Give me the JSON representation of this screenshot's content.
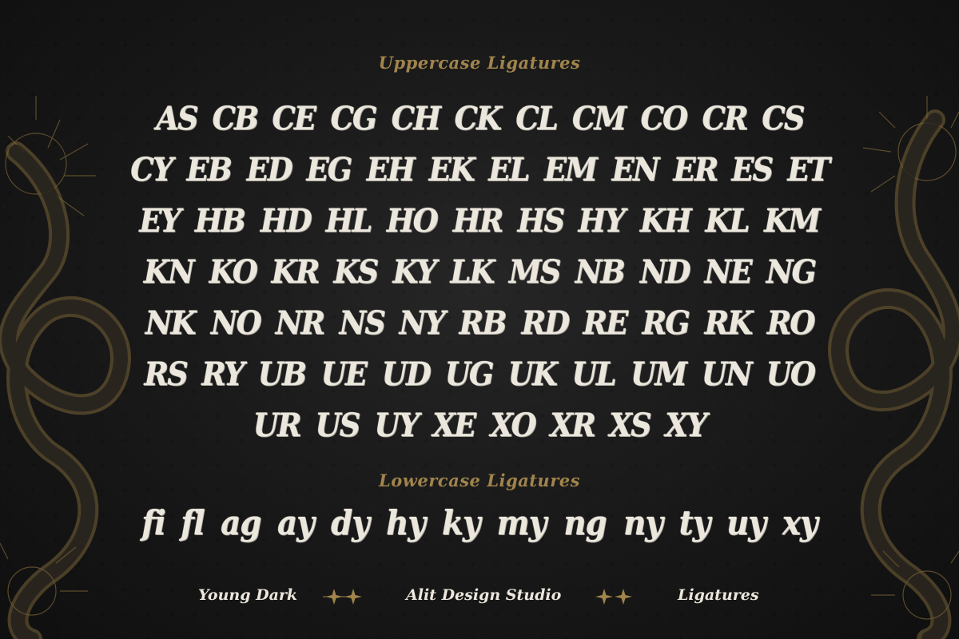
{
  "uppercase": {
    "title": "Uppercase Ligatures",
    "rows": [
      [
        "AS",
        "CB",
        "CE",
        "CG",
        "CH",
        "CK",
        "CL",
        "CM",
        "CO",
        "CR",
        "CS"
      ],
      [
        "CY",
        "EB",
        "ED",
        "EG",
        "EH",
        "EK",
        "EL",
        "EM",
        "EN",
        "ER",
        "ES",
        "ET"
      ],
      [
        "EY",
        "HB",
        "HD",
        "HL",
        "HO",
        "HR",
        "HS",
        "HY",
        "KH",
        "KL",
        "KM"
      ],
      [
        "KN",
        "KO",
        "KR",
        "KS",
        "KY",
        "LK",
        "MS",
        "NB",
        "ND",
        "NE",
        "NG"
      ],
      [
        "NK",
        "NO",
        "NR",
        "NS",
        "NY",
        "RB",
        "RD",
        "RE",
        "RG",
        "RK",
        "RO"
      ],
      [
        "RS",
        "RY",
        "UB",
        "UE",
        "UD",
        "UG",
        "UK",
        "UL",
        "UM",
        "UN",
        "UO"
      ],
      [
        "UR",
        "US",
        "UY",
        "XE",
        "XO",
        "XR",
        "XS",
        "XY"
      ]
    ]
  },
  "lowercase": {
    "title": "Lowercase Ligatures",
    "items": [
      "fi",
      "fl",
      "ag",
      "ay",
      "dy",
      "hy",
      "ky",
      "my",
      "ng",
      "ny",
      "ty",
      "uy",
      "xy"
    ]
  },
  "footer": {
    "font_name": "Young Dark",
    "studio": "Alit Design Studio",
    "label": "Ligatures"
  },
  "colors": {
    "background": "#141414",
    "accent_gold": "#a0844c",
    "glyph_white": "#ece7dc"
  },
  "icons": {
    "decoration": "serpent-illustration",
    "separator": "four-point-star-pair"
  }
}
